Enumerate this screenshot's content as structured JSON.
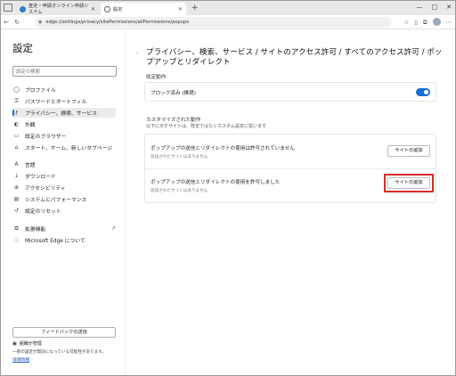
{
  "browser": {
    "tabs": [
      {
        "title": "査定・申請オンライン申請システム",
        "active": false
      },
      {
        "title": "設定",
        "active": true
      }
    ],
    "new_tab": "+",
    "address": "edge://settings/privacy/sitePermissions/allPermissions/popups",
    "window_buttons": [
      "—",
      "□",
      "✕"
    ]
  },
  "sidebar": {
    "title": "設定",
    "search_placeholder": "設定の検索",
    "items": [
      {
        "label": "プロファイル",
        "icon": "person-icon",
        "glyph": "◯"
      },
      {
        "label": "パスワードとオートフィル",
        "icon": "key-icon",
        "glyph": "⚿"
      },
      {
        "label": "プライバシー、検索、サービス",
        "icon": "lock-icon",
        "glyph": "🔒",
        "active": true
      },
      {
        "label": "外観",
        "icon": "appearance-icon",
        "glyph": "◐"
      },
      {
        "label": "既定のブラウザー",
        "icon": "browser-icon",
        "glyph": "▭"
      },
      {
        "label": "スタート、ホーム、新しいタブページ",
        "icon": "home-icon",
        "glyph": "⌂"
      },
      {
        "label": "言語",
        "icon": "language-icon",
        "glyph": "A"
      },
      {
        "label": "ダウンロード",
        "icon": "download-icon",
        "glyph": "↓"
      },
      {
        "label": "アクセシビリティ",
        "icon": "accessibility-icon",
        "glyph": "♿"
      },
      {
        "label": "システムとパフォーマンス",
        "icon": "system-icon",
        "glyph": "▤"
      },
      {
        "label": "設定のリセット",
        "icon": "reset-icon",
        "glyph": "↺"
      },
      {
        "label": "拡張機能",
        "icon": "extensions-icon",
        "glyph": "⧉"
      },
      {
        "label": "Microsoft Edge について",
        "icon": "edge-icon",
        "glyph": "◌"
      }
    ],
    "feedback_button": "フィードバックの送信",
    "org_label": "組織が管理",
    "note": "一部の設定が無効になっている可能性があります。",
    "note_link": "詳細情報"
  },
  "main": {
    "breadcrumb": "プライバシー、検索、サービス / サイトのアクセス許可 / すべてのアクセス許可 / ポップアップとリダイレクト",
    "default_section": "既定動作",
    "block_label": "ブロック済み (推奨)",
    "block_toggle_on": true,
    "custom_section": "カスタマイズされた動作",
    "custom_sub": "以下に示すサイトは、既定ではなくカスタム設定に従います",
    "block_list": {
      "label": "ポップアップの送信とリダイレクトの使用は許可されていません",
      "empty": "追加されたサイトはありません",
      "button": "サイトの追加"
    },
    "allow_list": {
      "label": "ポップアップの送信とリダイレクトの使用を許可しました",
      "empty": "追加されたサイトはありません",
      "button": "サイトの追加"
    }
  },
  "colors": {
    "accent": "#1a6ed8",
    "highlight": "#d62b2b"
  }
}
